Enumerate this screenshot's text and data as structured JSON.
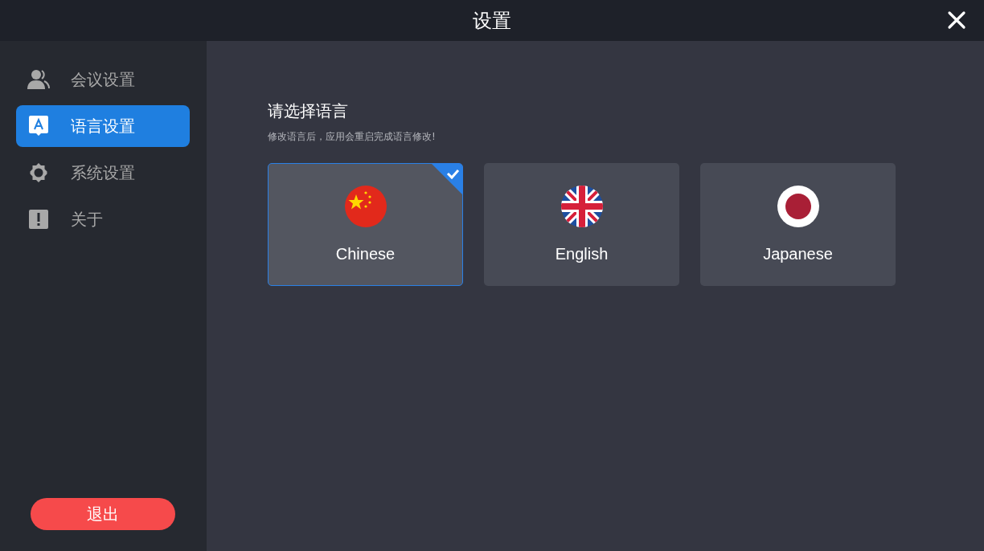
{
  "window": {
    "title": "设置"
  },
  "sidebar": {
    "items": [
      {
        "label": "会议设置",
        "kind": "people",
        "selected": false
      },
      {
        "label": "语言设置",
        "kind": "language",
        "selected": true
      },
      {
        "label": "系统设置",
        "kind": "gear",
        "selected": false
      },
      {
        "label": "关于",
        "kind": "info",
        "selected": false
      }
    ],
    "logout_button": "退出"
  },
  "language_panel": {
    "title": "请选择语言",
    "hint": "修改语言后，应用会重启完成语言修改!",
    "options": [
      {
        "label": "Chinese",
        "kind": "cn",
        "selected": true
      },
      {
        "label": "English",
        "kind": "uk",
        "selected": false
      },
      {
        "label": "Japanese",
        "kind": "jp",
        "selected": false
      }
    ]
  }
}
